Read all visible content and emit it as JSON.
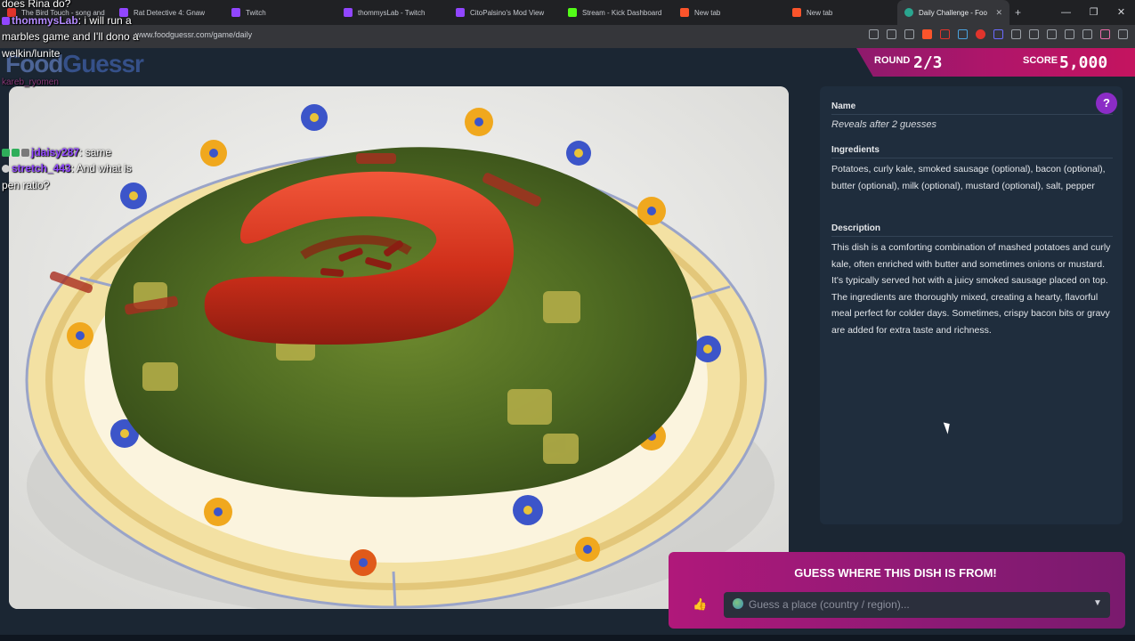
{
  "browser": {
    "tabs": [
      {
        "label": "The Bird Touch - song and",
        "icon_color": "#e0342c"
      },
      {
        "label": "Rat Detective 4: Gnaw",
        "icon_color": "#9146ff"
      },
      {
        "label": "Twitch",
        "icon_color": "#9146ff"
      },
      {
        "label": "thommysLab - Twitch",
        "icon_color": "#9146ff"
      },
      {
        "label": "CitoPalsino's Mod View",
        "icon_color": "#9146ff"
      },
      {
        "label": "Stream - Kick Dashboard",
        "icon_color": "#53fc18"
      },
      {
        "label": "New tab",
        "icon_color": "#fb542b"
      },
      {
        "label": "New tab",
        "icon_color": "#fb542b"
      },
      {
        "label": "Daily Challenge - Foo",
        "icon_color": "#2aa58f"
      }
    ],
    "url": "www.foodguessr.com/game/daily"
  },
  "site": {
    "logo_part1": "Food",
    "logo_part2": "Guessr"
  },
  "scoreboard": {
    "round_label": "ROUND",
    "round_value": "2/3",
    "score_label": "SCORE",
    "score_value": "5,000"
  },
  "info_panel": {
    "help": "?",
    "name_heading": "Name",
    "name_value": "Reveals after 2 guesses",
    "ingredients_heading": "Ingredients",
    "ingredients_text": "Potatoes, curly kale, smoked sausage (optional), bacon (optional), butter (optional), milk (optional), mustard (optional), salt, pepper",
    "description_heading": "Description",
    "description_text": "This dish is a comforting combination of mashed potatoes and curly kale, often enriched with butter and sometimes onions or mustard. It's typically served hot with a juicy smoked sausage placed on top. The ingredients are thoroughly mixed, creating a hearty, flavorful meal perfect for colder days. Sometimes, crispy bacon bits or gravy are added for extra taste and richness."
  },
  "guess": {
    "title": "GUESS WHERE THIS DISH IS FROM!",
    "placeholder": "Guess a place (country / region)..."
  },
  "chat": {
    "line1": "does Rina do?",
    "line2_user": "thommysLab",
    "line2_text": ": i will run a",
    "line3": "marbles game and I'll dono a",
    "line4": "welkin/lunite",
    "line5": "kareb_ryomen",
    "line6_user": "jdaisy287",
    "line6_text": ": same",
    "line7_user": "stretch_443",
    "line7_text": ": And what is",
    "line8": "pen ratio?"
  },
  "colors": {
    "accent": "#b0156a",
    "help": "#8b2cc6",
    "panel": "#1f2d3d",
    "page": "#1b2633"
  }
}
